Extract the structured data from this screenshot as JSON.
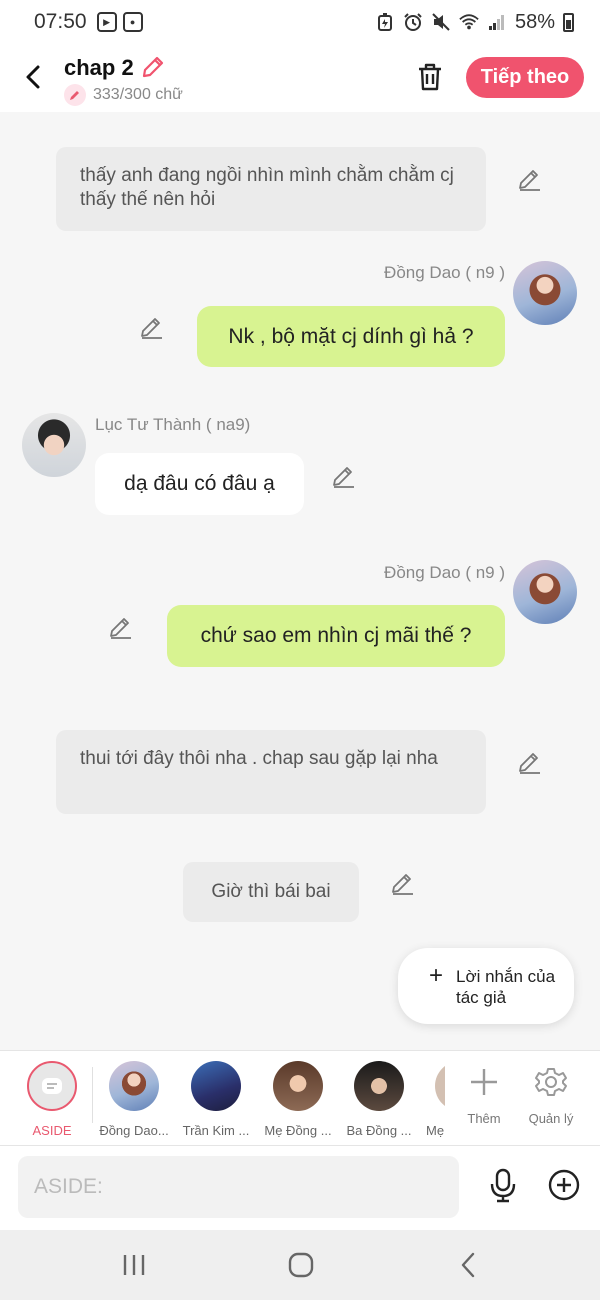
{
  "status_bar": {
    "time": "07:50",
    "battery": "58%"
  },
  "header": {
    "title": "chap 2",
    "counter": "333/300 chữ",
    "next_label": "Tiếp theo"
  },
  "messages": [
    {
      "type": "narration",
      "text": "thấy anh đang ngồi nhìn mình chằm chằm cj thấy thế nên hỏi"
    },
    {
      "type": "right",
      "name": "Đồng Dao ( n9 )",
      "text": "Nk , bộ mặt cj dính gì hả ?"
    },
    {
      "type": "left",
      "name": "Lục Tư Thành ( na9)",
      "text": "dạ đâu có đâu ạ"
    },
    {
      "type": "right",
      "name": "Đồng Dao ( n9 )",
      "text": "chứ sao em nhìn cj mãi thế ?"
    },
    {
      "type": "narration",
      "text": "thui tới đây thôi nha . chap sau gặp lại nha"
    },
    {
      "type": "narration",
      "text": "Giờ thì bái bai"
    }
  ],
  "author_note": {
    "label": "Lời nhắn của tác giả"
  },
  "characters": [
    {
      "name": "ASIDE"
    },
    {
      "name": "Đồng Dao..."
    },
    {
      "name": "Trần Kim ..."
    },
    {
      "name": "Mẹ Đồng ..."
    },
    {
      "name": "Ba Đồng ..."
    },
    {
      "name": "Mẹ"
    }
  ],
  "tools": {
    "add_label": "Thêm",
    "manage_label": "Quản lý"
  },
  "input": {
    "placeholder": "ASIDE:"
  },
  "colors": {
    "accent": "#f0536e",
    "green_bubble": "#d8f391",
    "narration_bg": "#ebebeb"
  }
}
